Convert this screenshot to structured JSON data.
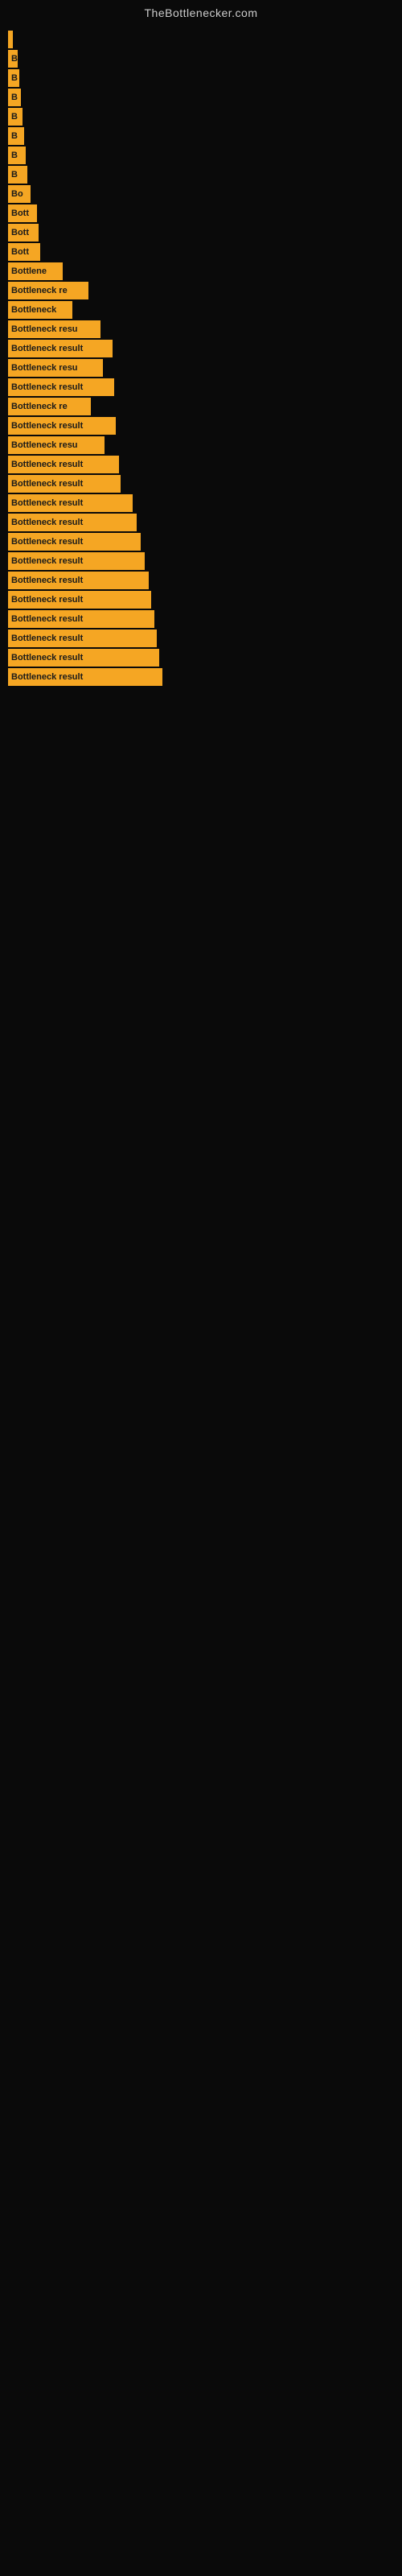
{
  "site": {
    "title": "TheBottlenecker.com"
  },
  "bars": [
    {
      "id": 1,
      "label": "",
      "width": 6
    },
    {
      "id": 2,
      "label": "B",
      "width": 12
    },
    {
      "id": 3,
      "label": "B",
      "width": 14
    },
    {
      "id": 4,
      "label": "B",
      "width": 16
    },
    {
      "id": 5,
      "label": "B",
      "width": 18
    },
    {
      "id": 6,
      "label": "B",
      "width": 20
    },
    {
      "id": 7,
      "label": "B",
      "width": 22
    },
    {
      "id": 8,
      "label": "B",
      "width": 24
    },
    {
      "id": 9,
      "label": "Bo",
      "width": 28
    },
    {
      "id": 10,
      "label": "Bott",
      "width": 36
    },
    {
      "id": 11,
      "label": "Bott",
      "width": 38
    },
    {
      "id": 12,
      "label": "Bott",
      "width": 40
    },
    {
      "id": 13,
      "label": "Bottlene",
      "width": 68
    },
    {
      "id": 14,
      "label": "Bottleneck re",
      "width": 100
    },
    {
      "id": 15,
      "label": "Bottleneck",
      "width": 80
    },
    {
      "id": 16,
      "label": "Bottleneck resu",
      "width": 115
    },
    {
      "id": 17,
      "label": "Bottleneck result",
      "width": 130
    },
    {
      "id": 18,
      "label": "Bottleneck resu",
      "width": 118
    },
    {
      "id": 19,
      "label": "Bottleneck result",
      "width": 132
    },
    {
      "id": 20,
      "label": "Bottleneck re",
      "width": 103
    },
    {
      "id": 21,
      "label": "Bottleneck result",
      "width": 134
    },
    {
      "id": 22,
      "label": "Bottleneck resu",
      "width": 120
    },
    {
      "id": 23,
      "label": "Bottleneck result",
      "width": 138
    },
    {
      "id": 24,
      "label": "Bottleneck result",
      "width": 140
    },
    {
      "id": 25,
      "label": "Bottleneck result",
      "width": 155
    },
    {
      "id": 26,
      "label": "Bottleneck result",
      "width": 160
    },
    {
      "id": 27,
      "label": "Bottleneck result",
      "width": 165
    },
    {
      "id": 28,
      "label": "Bottleneck result",
      "width": 170
    },
    {
      "id": 29,
      "label": "Bottleneck result",
      "width": 175
    },
    {
      "id": 30,
      "label": "Bottleneck result",
      "width": 178
    },
    {
      "id": 31,
      "label": "Bottleneck result",
      "width": 182
    },
    {
      "id": 32,
      "label": "Bottleneck result",
      "width": 185
    },
    {
      "id": 33,
      "label": "Bottleneck result",
      "width": 188
    },
    {
      "id": 34,
      "label": "Bottleneck result",
      "width": 192
    }
  ]
}
